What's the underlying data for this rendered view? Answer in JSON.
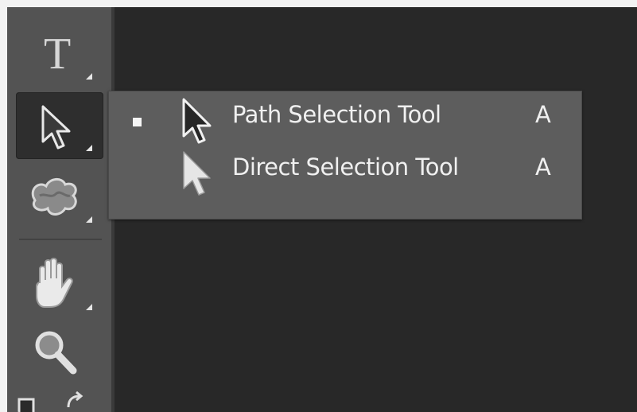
{
  "toolbar": {
    "tools": [
      {
        "name": "type-tool",
        "icon": "type-icon",
        "glyph": "T",
        "active": false
      },
      {
        "name": "path-selection-tool",
        "icon": "path-selection-arrow-icon",
        "active": true
      },
      {
        "name": "custom-shape-tool",
        "icon": "custom-shape-blob-icon",
        "active": false
      },
      {
        "name": "hand-tool",
        "icon": "hand-icon",
        "active": false
      },
      {
        "name": "zoom-tool",
        "icon": "magnifier-icon",
        "active": false
      }
    ],
    "colors": {
      "panel": "#535353",
      "active_bg": "#2e2e2e",
      "icon": "#dcdcdc"
    }
  },
  "flyout": {
    "items": [
      {
        "label": "Path Selection Tool",
        "shortcut": "A",
        "icon": "black-arrow-icon",
        "selected": true
      },
      {
        "label": "Direct Selection Tool",
        "shortcut": "A",
        "icon": "white-arrow-icon",
        "selected": false
      }
    ],
    "colors": {
      "background": "#5d5d5d",
      "text": "#f0f0f0"
    }
  },
  "canvas": {
    "background": "#282828"
  }
}
